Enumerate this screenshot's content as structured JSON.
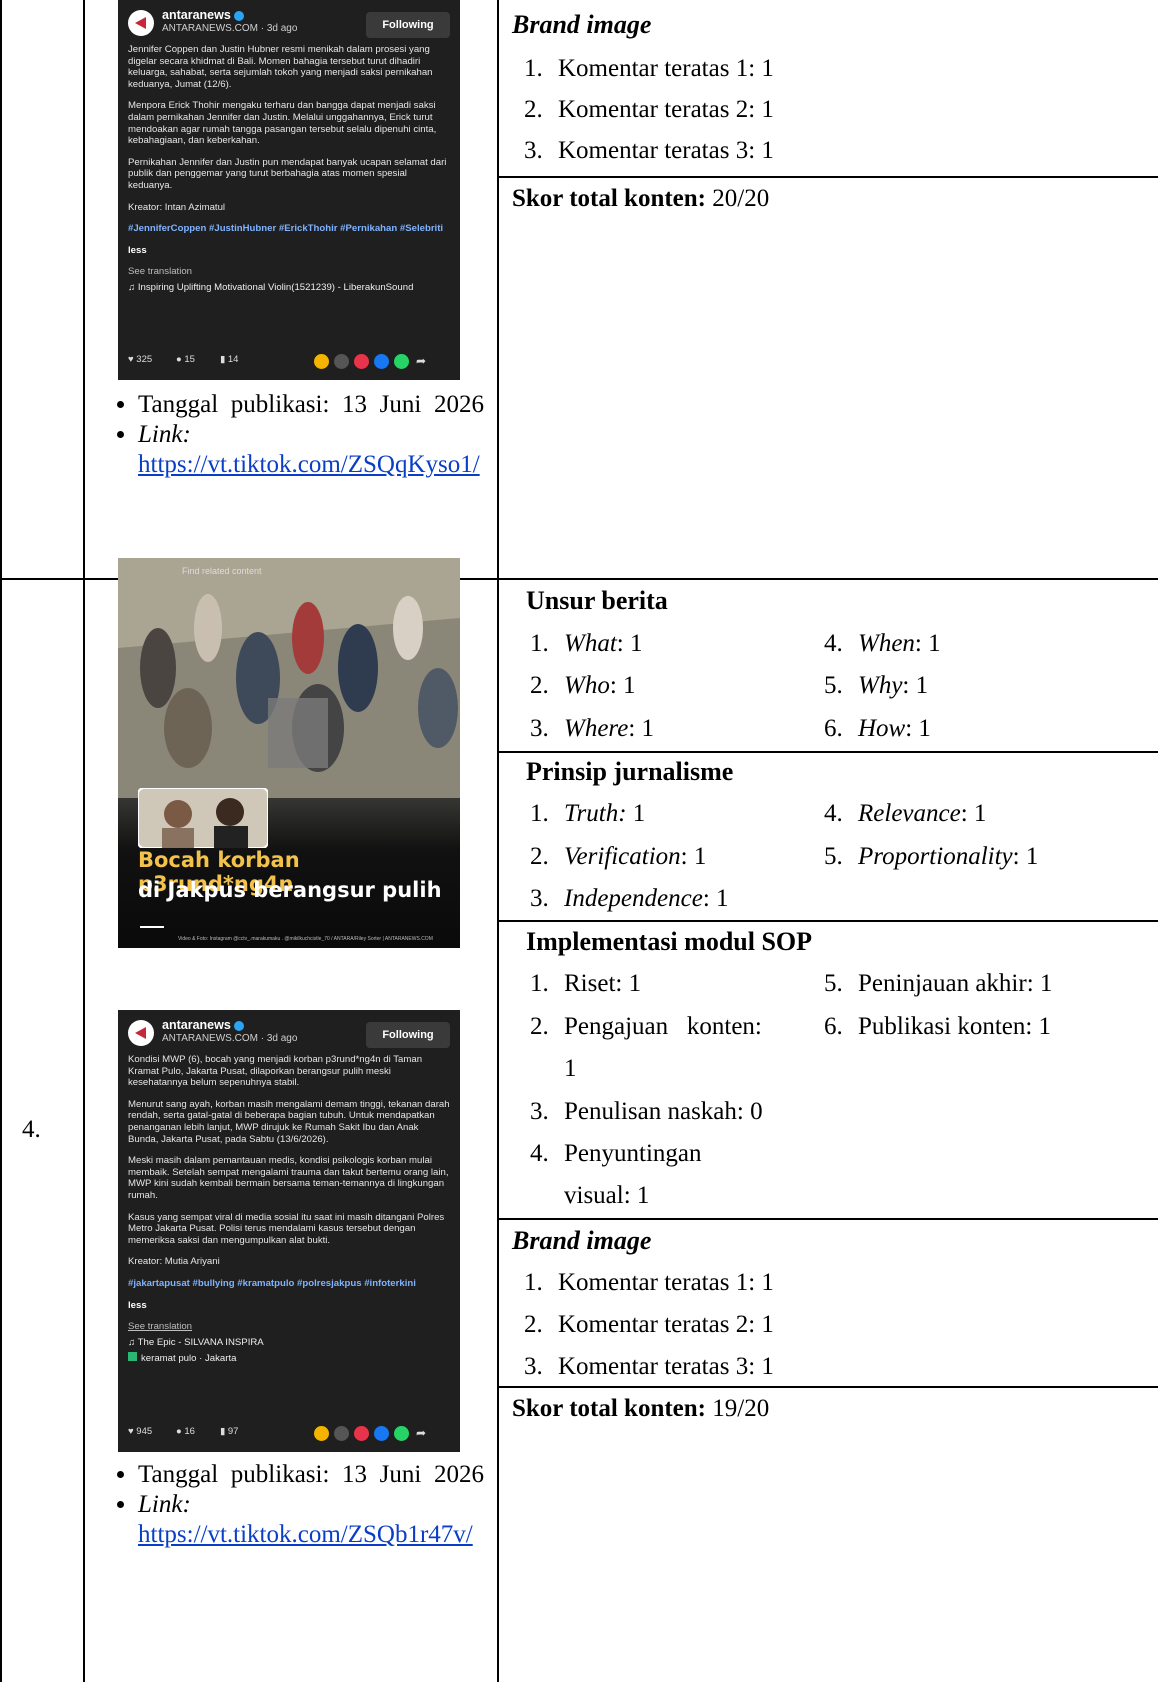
{
  "row3": {
    "post": {
      "account": "antaranews",
      "meta": "ANTARANEWS.COM · 3d ago",
      "follow": "Following",
      "para1": "Jennifer Coppen dan Justin Hubner resmi menikah dalam prosesi yang digelar secara khidmat di Bali. Momen bahagia tersebut turut dihadiri keluarga, sahabat, serta sejumlah tokoh yang menjadi saksi pernikahan keduanya, Jumat (12/6).",
      "para2": "Menpora Erick Thohir mengaku terharu dan bangga dapat menjadi saksi dalam pernikahan Jennifer dan Justin. Melalui unggahannya, Erick turut mendoakan agar rumah tangga pasangan tersebut selalu dipenuhi cinta, kebahagiaan, dan keberkahan.",
      "para3": "Pernikahan Jennifer dan Justin pun mendapat banyak ucapan selamat dari publik dan penggemar yang turut berbahagia atas momen spesial keduanya.",
      "creator": "Kreator: Intan Azimatul",
      "tags": "#JenniferCoppen #JustinHubner #ErickThohir #Pernikahan #Selebriti",
      "less": "less",
      "translation": "See translation",
      "music": "♫  Inspiring Uplifting Motivational Violin(1521239) - LiberakunSound",
      "likes": "325",
      "comments": "15",
      "saves": "14"
    },
    "date_label": "Tanggal publikasi: 13 Juni 2026",
    "link_label": "Link:",
    "link_url": "https://vt.tiktok.com/ZSQqKyso1/",
    "brand_title": "Brand image",
    "brand_items": [
      "Komentar teratas 1: 1",
      "Komentar teratas 2: 1",
      "Komentar teratas 3: 1"
    ],
    "score_label": "Skor total konten:",
    "score_value": "20/20"
  },
  "row4": {
    "number": "4.",
    "video": {
      "find": "Find related content",
      "caption1": "Bocah korban p3rund*ng4n",
      "caption2": "di Jakpus berangsur pulih",
      "credit": "Video & Foto: Instagram @cctv_.marakumaku . @mikilkuchcistle_70 / ANTARA/Riley Sorter  |  ANTARANEWS.COM"
    },
    "post": {
      "account": "antaranews",
      "meta": "ANTARANEWS.COM · 3d ago",
      "follow": "Following",
      "para1": "Kondisi MWP (6), bocah yang menjadi korban p3rund*ng4n di Taman Kramat Pulo, Jakarta Pusat, dilaporkan berangsur pulih meski kesehatannya belum sepenuhnya stabil.",
      "para2": "Menurut sang ayah, korban masih mengalami demam tinggi, tekanan darah rendah, serta gatal-gatal di beberapa bagian tubuh. Untuk mendapatkan penanganan lebih lanjut, MWP dirujuk ke Rumah Sakit Ibu dan Anak Bunda, Jakarta Pusat, pada Sabtu (13/6/2026).",
      "para3": "Meski masih dalam pemantauan medis, kondisi psikologis korban mulai membaik. Setelah sempat mengalami trauma dan takut bertemu orang lain, MWP kini sudah kembali bermain bersama teman-temannya di lingkungan rumah.",
      "para4": "Kasus yang sempat viral di media sosial itu saat ini masih ditangani Polres Metro Jakarta Pusat. Polisi terus mendalami kasus tersebut dengan memeriksa saksi dan mengumpulkan alat bukti.",
      "creator": "Kreator: Mutia Ariyani",
      "tags": "#jakartapusat #bullying #kramatpulo #polresjakpus #infoterkini",
      "less": "less",
      "translation": "See translation",
      "music": "♫  The Epic - SILVANA INSPIRA",
      "location": "keramat pulo · Jakarta",
      "likes": "945",
      "comments": "16",
      "saves": "97"
    },
    "date_label": "Tanggal publikasi: 13 Juni 2026",
    "link_label": "Link:",
    "link_url": "https://vt.tiktok.com/ZSQb1r47v/",
    "unsur_title": "Unsur berita",
    "unsur": [
      {
        "n": "1.",
        "k": "What",
        "v": ": 1"
      },
      {
        "n": "2.",
        "k": "Who",
        "v": ": 1"
      },
      {
        "n": "3.",
        "k": "Where",
        "v": ": 1"
      },
      {
        "n": "4.",
        "k": "When",
        "v": ": 1"
      },
      {
        "n": "5.",
        "k": "Why",
        "v": ": 1"
      },
      {
        "n": "6.",
        "k": "How",
        "v": ": 1"
      }
    ],
    "prinsip_title": "Prinsip jurnalisme",
    "prinsip": [
      {
        "n": "1.",
        "k": "Truth:",
        "v": " 1"
      },
      {
        "n": "2.",
        "k": "Verification",
        "v": ": 1"
      },
      {
        "n": "3.",
        "k": "Independence",
        "v": ": 1"
      },
      {
        "n": "4.",
        "k": "Relevance",
        "v": ": 1"
      },
      {
        "n": "5.",
        "k": "Proportionality",
        "v": ": 1"
      }
    ],
    "sop_title": "Implementasi modul SOP",
    "sop_left": [
      {
        "n": "1.",
        "t": "Riset: 1"
      },
      {
        "n": "2.",
        "t": "Pengajuan   konten:"
      },
      {
        "n": "",
        "t": "1"
      },
      {
        "n": "3.",
        "t": "Penulisan naskah: 0"
      },
      {
        "n": "4.",
        "t": "Penyuntingan"
      },
      {
        "n": "",
        "t": "visual: 1"
      }
    ],
    "sop_right": [
      {
        "n": "5.",
        "t": "Peninjauan akhir: 1"
      },
      {
        "n": "6.",
        "t": "Publikasi konten: 1"
      }
    ],
    "brand_title": "Brand image",
    "brand_items": [
      "Komentar teratas 1: 1",
      "Komentar teratas 2: 1",
      "Komentar teratas 3: 1"
    ],
    "score_label": "Skor total konten:",
    "score_value": "19/20"
  }
}
